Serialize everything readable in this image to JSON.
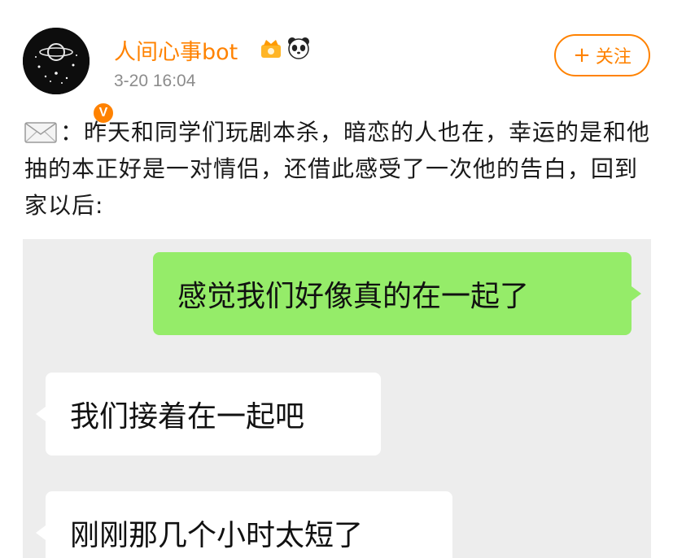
{
  "post": {
    "username": "人间心事bot",
    "timestamp": "3-20 16:04",
    "follow_label": "关注",
    "badges": [
      "crown-badge-icon",
      "panda-icon"
    ],
    "text_icon": "envelope-icon",
    "text": "：昨天和同学们玩剧本杀，暗恋的人也在，幸运的是和他抽的本正好是一对情侣，还借此感受了一次他的告白，回到家以后:"
  },
  "chat": {
    "messages": [
      {
        "side": "right",
        "text": "感觉我们好像真的在一起了"
      },
      {
        "side": "left",
        "text": "我们接着在一起吧"
      },
      {
        "side": "left",
        "text": "刚刚那几个小时太短了"
      }
    ]
  },
  "colors": {
    "accent": "#ff8200",
    "chat_background": "#ededed",
    "sent_bubble": "#95ec69",
    "received_bubble": "#ffffff"
  }
}
